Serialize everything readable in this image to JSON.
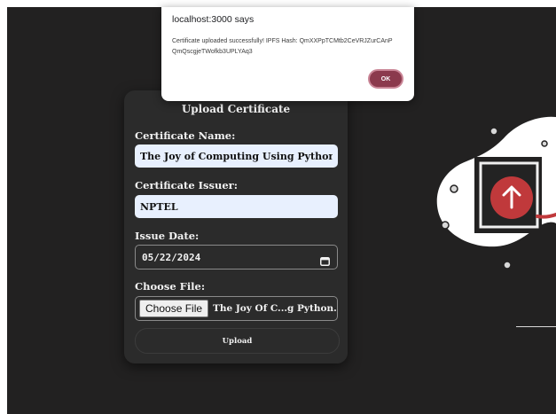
{
  "form": {
    "title": "Upload Certificate",
    "name_label": "Certificate Name:",
    "name_value": "The Joy of Computing Using Python",
    "issuer_label": "Certificate Issuer:",
    "issuer_value": "NPTEL",
    "date_label": "Issue Date:",
    "date_value": "05/22/2024",
    "file_label": "Choose File:",
    "file_button_label": "Choose File",
    "file_name": "The Joy Of C...g Python.pdf",
    "upload_label": "Upload"
  },
  "dialog": {
    "title": "localhost:3000 says",
    "message": "Certificate uploaded successfully! IPFS Hash: QmXXPpTCMtb2CeVRJZurCAnPQmQscgjeTWofkb3UPLYAq3",
    "ok_label": "OK"
  },
  "illustration": {
    "icon": "upload-arrow-icon",
    "accent": "#c0393b"
  }
}
